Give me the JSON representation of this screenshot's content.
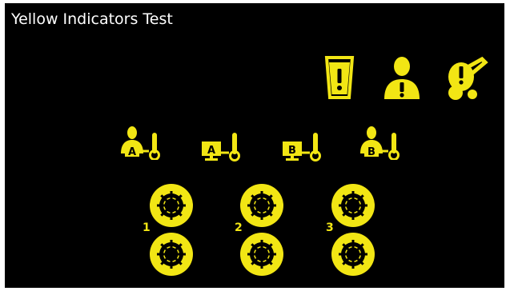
{
  "window": {
    "title": "Yellow Indicators Test"
  },
  "colors": {
    "indicator": "#f2e614",
    "background": "#000000",
    "title": "#ffffff"
  },
  "top_indicators": [
    {
      "icon": "beverage-cup-warning-icon"
    },
    {
      "icon": "operator-warning-icon"
    },
    {
      "icon": "equipment-fault-warning-icon"
    }
  ],
  "temperature_indicators": [
    {
      "icon": "operator-a-temperature-icon",
      "letter": "A"
    },
    {
      "icon": "display-a-temperature-icon",
      "letter": "A"
    },
    {
      "icon": "display-b-temperature-icon",
      "letter": "B"
    },
    {
      "icon": "operator-b-temperature-icon",
      "letter": "B"
    }
  ],
  "gear_groups": [
    {
      "label": "1",
      "icons": [
        "gear-top-icon",
        "gear-bottom-icon"
      ]
    },
    {
      "label": "2",
      "icons": [
        "gear-top-icon",
        "gear-bottom-icon"
      ]
    },
    {
      "label": "3",
      "icons": [
        "gear-top-icon",
        "gear-bottom-icon"
      ]
    }
  ]
}
